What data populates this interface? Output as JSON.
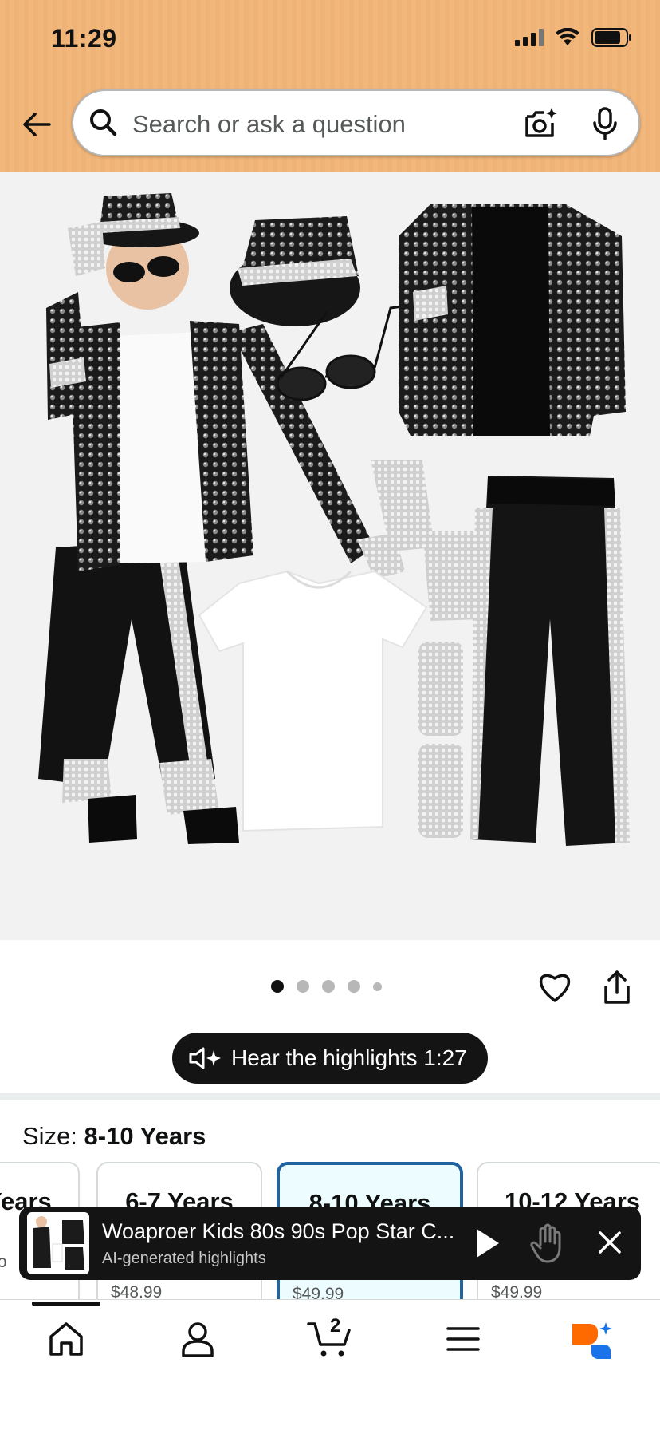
{
  "status_bar": {
    "time": "11:29"
  },
  "search": {
    "placeholder": "Search or ask a question"
  },
  "gallery": {
    "image_count": 5,
    "active_index": 0
  },
  "highlights_button": {
    "label": "Hear the highlights 1:27"
  },
  "size": {
    "label": "Size: ",
    "selected": "8-10 Years",
    "options": [
      {
        "label": "Years",
        "price": "",
        "fragment": "fro"
      },
      {
        "label": "6-7 Years",
        "price": "$48.99"
      },
      {
        "label": "8-10 Years",
        "price": "$49.99"
      },
      {
        "label": "10-12 Years",
        "price": "$49.99"
      }
    ]
  },
  "audio_player": {
    "title": "Woaproer Kids 80s 90s Pop Star C...",
    "subtitle": "AI-generated highlights"
  },
  "bottom_nav": {
    "cart_count": "2"
  },
  "colors": {
    "header": "#f1b77b",
    "selected_border": "#2162a1",
    "selected_bg": "#edfdff",
    "rufus_orange": "#ff6a00",
    "rufus_blue": "#1a73e8"
  }
}
